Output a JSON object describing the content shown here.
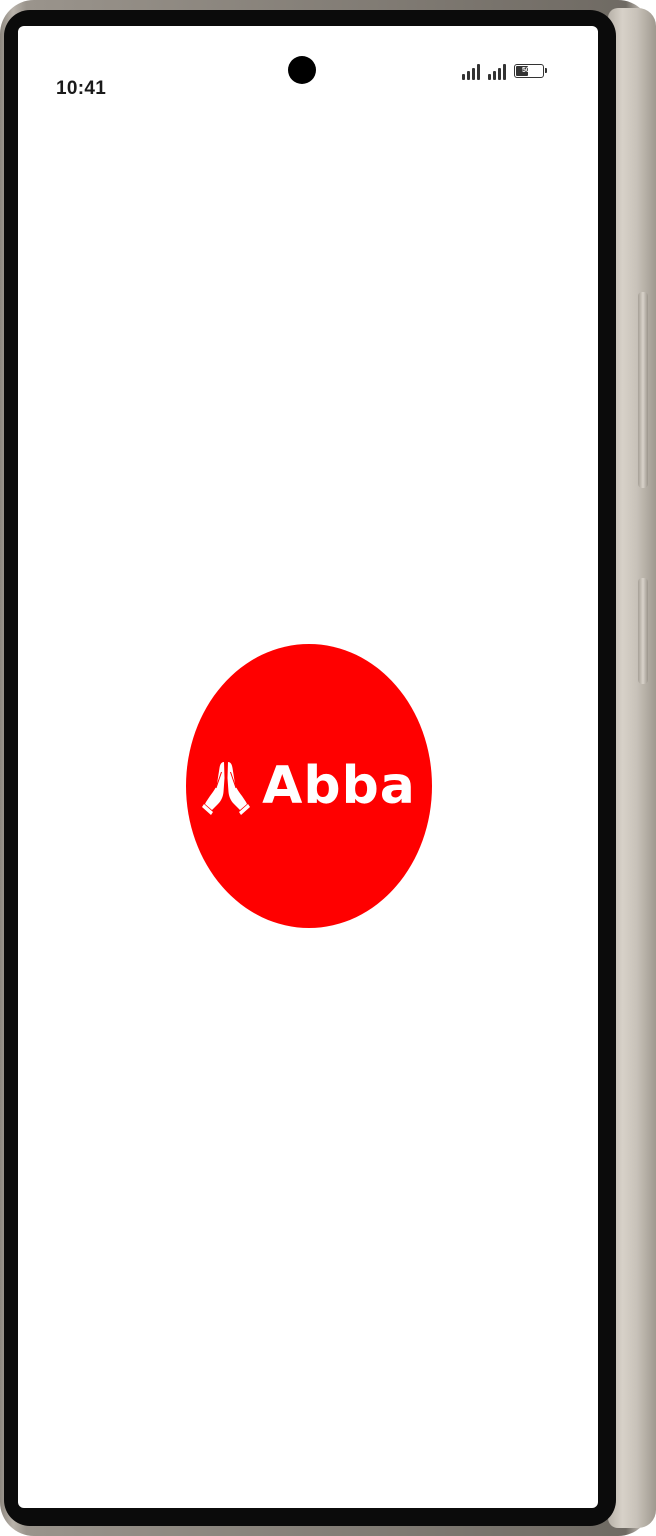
{
  "status_bar": {
    "time": "10:41",
    "battery_text": "50%",
    "battery_level": 0.5
  },
  "splash": {
    "app_name": "Abba",
    "logo_color": "#ff0000",
    "logo_icon": "praying-hands-icon",
    "background_color": "#ffffff"
  }
}
